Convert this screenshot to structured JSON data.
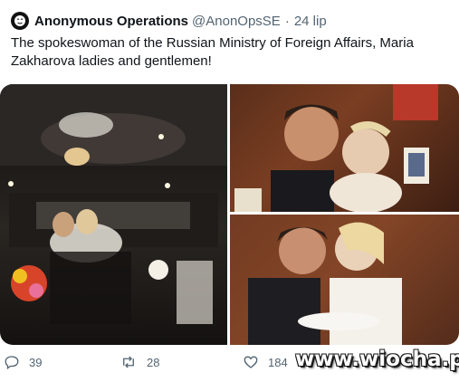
{
  "tweet": {
    "author_name": "Anonymous Operations",
    "author_handle": "@AnonOpsSE",
    "separator": "·",
    "date": "24 lip",
    "text": "The spokeswoman of the Russian Ministry of Foreign Affairs, Maria Zakharova ladies and gentlemen!"
  },
  "media": {
    "photo_count": 3
  },
  "actions": {
    "replies": "39",
    "retweets": "28",
    "likes": "184",
    "icons": [
      "reply-icon",
      "retweet-icon",
      "like-icon"
    ]
  },
  "watermark": "www.wiocha.pl",
  "colors": {
    "text": "#0f1419",
    "secondary": "#536471",
    "background": "#ffffff"
  }
}
